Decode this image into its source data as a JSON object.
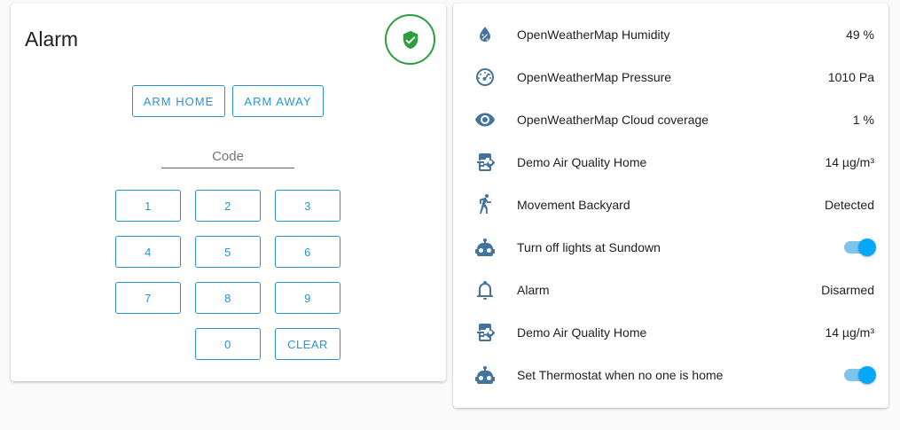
{
  "alarm": {
    "title": "Alarm",
    "state_icon": "shield-check-icon",
    "arm_home_label": "ARM HOME",
    "arm_away_label": "ARM AWAY",
    "code_placeholder": "Code",
    "code_value": "",
    "keypad": [
      "1",
      "2",
      "3",
      "4",
      "5",
      "6",
      "7",
      "8",
      "9",
      "0"
    ],
    "clear_label": "CLEAR",
    "colors": {
      "accent": "#2b93d1",
      "armed_state": "#2e9d3f"
    }
  },
  "entities": [
    {
      "icon": "water-percent-icon",
      "name": "OpenWeatherMap Humidity",
      "value": "49 %"
    },
    {
      "icon": "gauge-icon",
      "name": "OpenWeatherMap Pressure",
      "value": "1010 Pa"
    },
    {
      "icon": "eye-icon",
      "name": "OpenWeatherMap Cloud coverage",
      "value": "1 %"
    },
    {
      "icon": "air-filter-icon",
      "name": "Demo Air Quality Home",
      "value": "14 µg/m³"
    },
    {
      "icon": "walk-icon",
      "name": "Movement Backyard",
      "value": "Detected"
    },
    {
      "icon": "robot-icon",
      "name": "Turn off lights at Sundown",
      "toggle": true
    },
    {
      "icon": "bell-outline-icon",
      "name": "Alarm",
      "value": "Disarmed"
    },
    {
      "icon": "air-filter-icon",
      "name": "Demo Air Quality Home",
      "value": "14 µg/m³"
    },
    {
      "icon": "robot-icon",
      "name": "Set Thermostat when no one is home",
      "toggle": true
    }
  ],
  "colors": {
    "icon": "#44739e",
    "toggle_on": "#03a9f4"
  }
}
